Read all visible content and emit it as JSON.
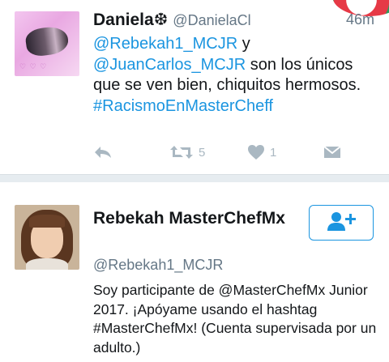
{
  "tweet": {
    "author_name": "Daniela❆",
    "author_handle": "@DanielaCl",
    "timestamp": "46m",
    "text": {
      "mention1": "@Rebekah1_MCJR",
      "connector": " y",
      "mention2": "@JuanCarlos_MCJR",
      "rest": " son los únicos que se ven bien, chiquitos hermosos.",
      "hashtag": "#RacismoEnMasterCheff"
    },
    "actions": {
      "reply_icon": "reply-icon",
      "retweet_icon": "retweet-icon",
      "retweet_count": "5",
      "like_icon": "heart-icon",
      "like_count": "1",
      "dm_icon": "envelope-icon"
    }
  },
  "profile_card": {
    "name": "Rebekah MasterChefMx",
    "handle": "@Rebekah1_MCJR",
    "bio": "Soy participante de @MasterChefMx Junior 2017. ¡Apóyame usando el hashtag #MasterChefMx! (Cuenta supervisada por un adulto.)",
    "follow_icon": "follow-user-icon"
  },
  "colors": {
    "link": "#1b95e0",
    "icon_gray": "#aab8c2",
    "secondary_text": "#657786",
    "divider": "#e6ecf0"
  }
}
